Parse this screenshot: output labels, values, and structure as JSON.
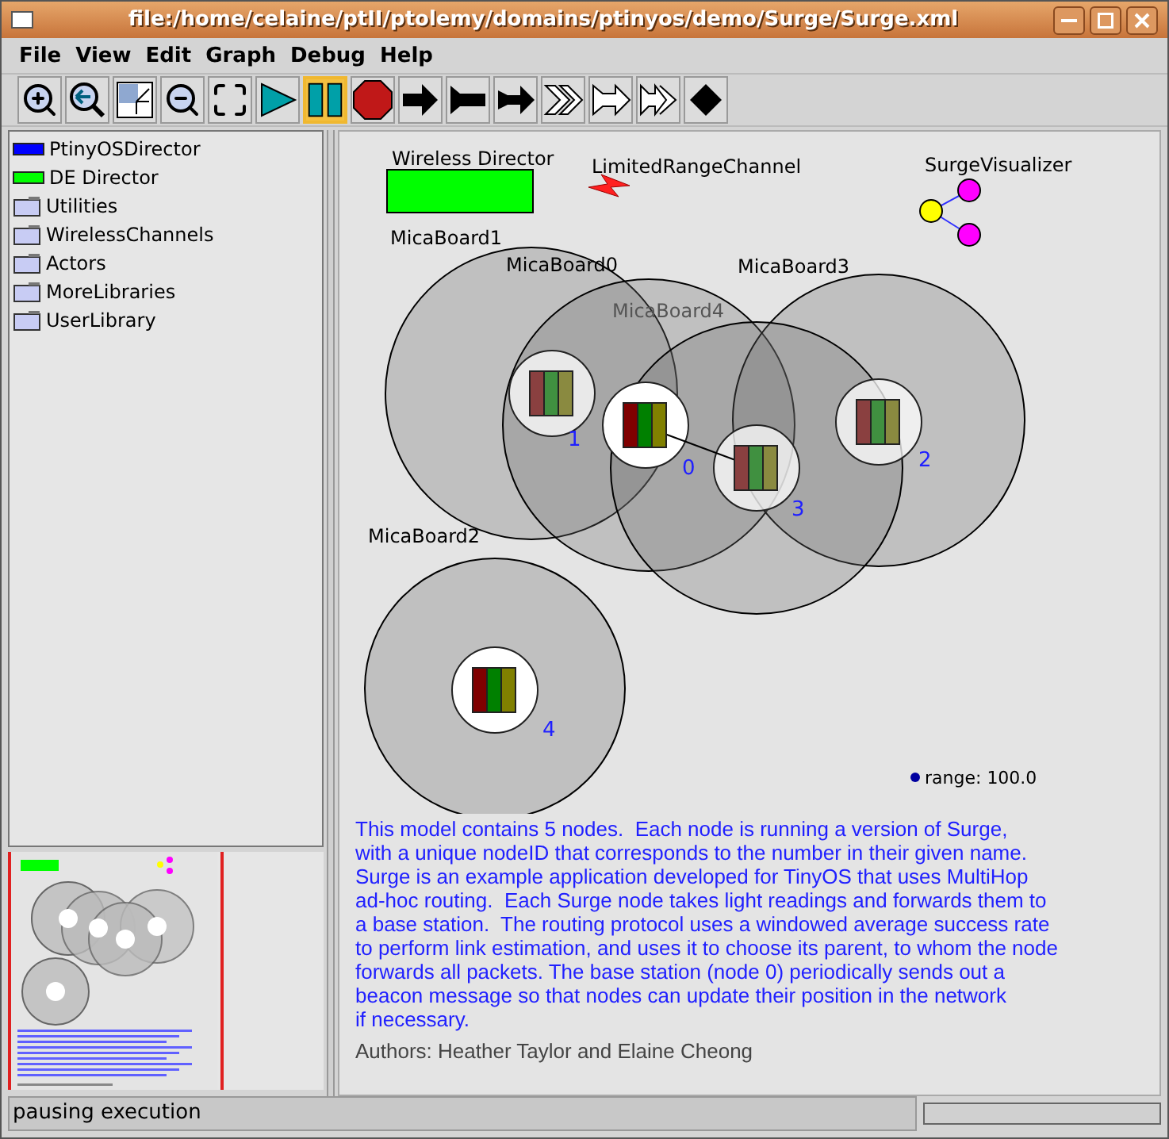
{
  "window": {
    "title": "file:/home/celaine/ptII/ptolemy/domains/ptinyos/demo/Surge/Surge.xml"
  },
  "menu": [
    "File",
    "View",
    "Edit",
    "Graph",
    "Debug",
    "Help"
  ],
  "toolbar": [
    {
      "kind": "zoom-in",
      "selected": false
    },
    {
      "kind": "zoom-reset",
      "selected": false
    },
    {
      "kind": "fit",
      "selected": false
    },
    {
      "kind": "zoom-out",
      "selected": false
    },
    {
      "kind": "full",
      "selected": false
    },
    {
      "kind": "run",
      "selected": false
    },
    {
      "kind": "pause",
      "selected": true
    },
    {
      "kind": "stop",
      "selected": false
    },
    {
      "kind": "arrow",
      "selected": false
    },
    {
      "kind": "arrow-back",
      "selected": false
    },
    {
      "kind": "arrow-both",
      "selected": false
    },
    {
      "kind": "hollow-double",
      "selected": false
    },
    {
      "kind": "hollow-back",
      "selected": false
    },
    {
      "kind": "hollow-both",
      "selected": false
    },
    {
      "kind": "diamond",
      "selected": false
    }
  ],
  "library": [
    {
      "kind": "director",
      "label": "PtinyOSDirector",
      "color": "#0000ff"
    },
    {
      "kind": "director",
      "label": "DE Director",
      "color": "#00ff00"
    },
    {
      "kind": "folder",
      "label": "Utilities"
    },
    {
      "kind": "folder",
      "label": "WirelessChannels"
    },
    {
      "kind": "folder",
      "label": "Actors"
    },
    {
      "kind": "folder",
      "label": "MoreLibraries"
    },
    {
      "kind": "folder",
      "label": "UserLibrary"
    }
  ],
  "canvas": {
    "director": "Wireless Director",
    "channel": "LimitedRangeChannel",
    "visualizer": "SurgeVisualizer",
    "boards": [
      {
        "name": "MicaBoard1",
        "id": "1"
      },
      {
        "name": "MicaBoard0",
        "id": "0"
      },
      {
        "name": "MicaBoard3",
        "id": "2"
      },
      {
        "name": "MicaBoard4",
        "id": "3"
      },
      {
        "name": "MicaBoard2",
        "id": "4"
      }
    ],
    "range": "range: 100.0",
    "description": "This model contains 5 nodes.  Each node is running a version of Surge,\nwith a unique nodeID that corresponds to the number in their given name.\nSurge is an example application developed for TinyOS that uses MultiHop\nad-hoc routing.  Each Surge node takes light readings and forwards them to\na base station.  The routing protocol uses a windowed average success rate\nto perform link estimation, and uses it to choose its parent, to whom the node\nforwards all packets. The base station (node 0) periodically sends out a\nbeacon message so that nodes can update their position in the network\nif necessary.",
    "authors": "Authors: Heather Taylor and Elaine Cheong"
  },
  "status_bar": {
    "message": "pausing execution",
    "progress": {
      "level": 0
    }
  }
}
